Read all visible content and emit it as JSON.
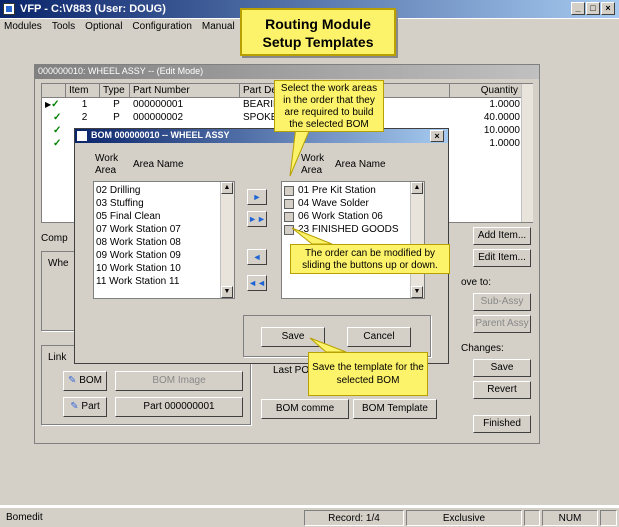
{
  "window": {
    "title": "VFP - C:\\V883 (User: DOUG)",
    "controls": [
      "_",
      "□",
      "×"
    ]
  },
  "menu": [
    "Modules",
    "Tools",
    "Optional",
    "Configuration",
    "Manual"
  ],
  "mdi": {
    "title": "000000010: WHEEL ASSY -- (Edit Mode)",
    "columns": {
      "item": "Item",
      "type": "Type",
      "part": "Part Number",
      "desc": "Part Des",
      "qty": "Quantity"
    },
    "rows": [
      {
        "item": "1",
        "type": "P",
        "part": "000000001",
        "desc": "BEARING",
        "qty": "1.0000"
      },
      {
        "item": "2",
        "type": "P",
        "part": "000000002",
        "desc": "SPOKE",
        "qty": "40.0000"
      },
      {
        "item": "",
        "type": "",
        "part": "",
        "desc": "",
        "qty": "10.0000"
      },
      {
        "item": "",
        "type": "",
        "part": "",
        "desc": "",
        "qty": "1.0000"
      }
    ],
    "comp_label": "Comp",
    "whe_label": "Whe",
    "link_label": "Link",
    "bom_button": "BOM",
    "bom_image_button": "BOM Image",
    "part_button": "Part",
    "part_field": "Part 000000001",
    "last_po": "Last PO",
    "bom_comments": "BOM comme",
    "bom_template": "BOM Template",
    "right_buttons": {
      "add": "Add Item...",
      "edit": "Edit Item...",
      "move_to": "ove to:",
      "sub_assy": "Sub-Assy",
      "parent_assy": "Parent Assy",
      "changes": "Changes:",
      "save": "Save",
      "revert": "Revert",
      "finished": "Finished"
    }
  },
  "dialog": {
    "title": "BOM 000000010 -- WHEEL ASSY",
    "left_header": {
      "work": "Work",
      "area": "Area",
      "name": "Area Name"
    },
    "left_items": [
      "02 Drilling",
      "03 Stuffing",
      "05 Final Clean",
      "07 Work Station 07",
      "08 Work Station 08",
      "09 Work Station 09",
      "10 Work Station 10",
      "11 Work Station 11"
    ],
    "right_header": {
      "work": "Work",
      "area": "Area",
      "name": "Area Name"
    },
    "right_items": [
      "01 Pre Kit Station",
      "04 Wave Solder",
      "06 Work Station 06",
      "23 FINISHED GOODS"
    ],
    "move": {
      "right": "►",
      "all_right": "►►",
      "left": "◄",
      "all_left": "◄◄"
    },
    "save": "Save",
    "cancel": "Cancel"
  },
  "callouts": {
    "title": "Routing Module Setup Templates",
    "select": "Select the work areas in the order that they are required to build the selected BOM",
    "order": "The order can be modified by sliding the buttons up or down.",
    "save": "Save the template for the selected BOM"
  },
  "status": {
    "app": "Bomedit",
    "record": "Record: 1/4",
    "mode": "Exclusive",
    "num": "NUM"
  }
}
